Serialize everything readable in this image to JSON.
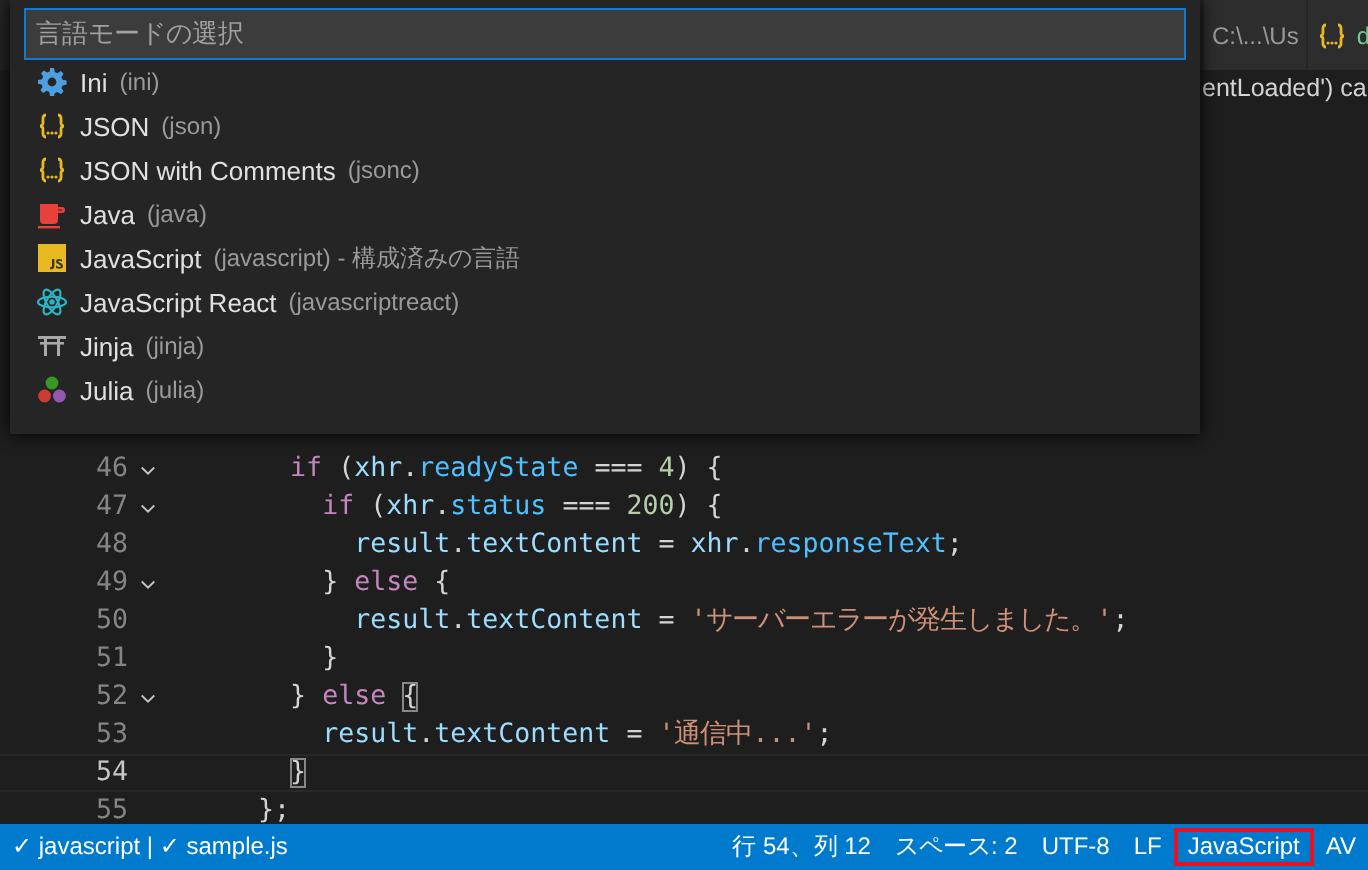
{
  "tab_bar": {
    "tabs": [
      {
        "kind": "path",
        "text": "C:\\...\\Us"
      },
      {
        "kind": "json",
        "text": "d"
      }
    ]
  },
  "editor": {
    "peek_fragment": "entLoaded') ca",
    "lines": [
      {
        "number": "46",
        "fold": true,
        "current": false,
        "tokens": [
          {
            "kind": "keyword",
            "text": "        if"
          },
          {
            "kind": "plain",
            "text": " ("
          },
          {
            "kind": "variable",
            "text": "xhr"
          },
          {
            "kind": "plain",
            "text": "."
          },
          {
            "kind": "property",
            "text": "readyState"
          },
          {
            "kind": "plain",
            "text": " === "
          },
          {
            "kind": "number",
            "text": "4"
          },
          {
            "kind": "plain",
            "text": ") {"
          }
        ]
      },
      {
        "number": "47",
        "fold": true,
        "current": false,
        "tokens": [
          {
            "kind": "keyword",
            "text": "          if"
          },
          {
            "kind": "plain",
            "text": " ("
          },
          {
            "kind": "variable",
            "text": "xhr"
          },
          {
            "kind": "plain",
            "text": "."
          },
          {
            "kind": "property",
            "text": "status"
          },
          {
            "kind": "plain",
            "text": " === "
          },
          {
            "kind": "number",
            "text": "200"
          },
          {
            "kind": "plain",
            "text": ") {"
          }
        ]
      },
      {
        "number": "48",
        "fold": false,
        "current": false,
        "tokens": [
          {
            "kind": "variable",
            "text": "            result"
          },
          {
            "kind": "plain",
            "text": "."
          },
          {
            "kind": "variable",
            "text": "textContent"
          },
          {
            "kind": "plain",
            "text": " = "
          },
          {
            "kind": "variable",
            "text": "xhr"
          },
          {
            "kind": "plain",
            "text": "."
          },
          {
            "kind": "property",
            "text": "responseText"
          },
          {
            "kind": "plain",
            "text": ";"
          }
        ]
      },
      {
        "number": "49",
        "fold": true,
        "current": false,
        "tokens": [
          {
            "kind": "plain",
            "text": "          } "
          },
          {
            "kind": "keyword",
            "text": "else"
          },
          {
            "kind": "plain",
            "text": " {"
          }
        ]
      },
      {
        "number": "50",
        "fold": false,
        "current": false,
        "tokens": [
          {
            "kind": "variable",
            "text": "            result"
          },
          {
            "kind": "plain",
            "text": "."
          },
          {
            "kind": "variable",
            "text": "textContent"
          },
          {
            "kind": "plain",
            "text": " = "
          },
          {
            "kind": "string",
            "text": "'サーバーエラーが発生しました。'"
          },
          {
            "kind": "plain",
            "text": ";"
          }
        ]
      },
      {
        "number": "51",
        "fold": false,
        "current": false,
        "tokens": [
          {
            "kind": "plain",
            "text": "          }"
          }
        ]
      },
      {
        "number": "52",
        "fold": true,
        "current": false,
        "tokens": [
          {
            "kind": "plain",
            "text": "        } "
          },
          {
            "kind": "keyword",
            "text": "else"
          },
          {
            "kind": "bracket_match",
            "text": " {"
          }
        ]
      },
      {
        "number": "53",
        "fold": false,
        "current": false,
        "tokens": [
          {
            "kind": "variable",
            "text": "          result"
          },
          {
            "kind": "plain",
            "text": "."
          },
          {
            "kind": "variable",
            "text": "textContent"
          },
          {
            "kind": "plain",
            "text": " = "
          },
          {
            "kind": "string",
            "text": "'通信中...'"
          },
          {
            "kind": "plain",
            "text": ";"
          }
        ]
      },
      {
        "number": "54",
        "fold": false,
        "current": true,
        "tokens": [
          {
            "kind": "bracket_match",
            "text": "        }"
          }
        ]
      },
      {
        "number": "55",
        "fold": false,
        "current": false,
        "tokens": [
          {
            "kind": "plain",
            "text": "      };"
          }
        ]
      }
    ]
  },
  "picker": {
    "placeholder": "言語モードの選択",
    "items": [
      {
        "kind": "gear",
        "name": "Ini",
        "id": "(ini)"
      },
      {
        "kind": "braces",
        "name": "JSON",
        "id": "(json)"
      },
      {
        "kind": "braces",
        "name": "JSON with Comments",
        "id": "(jsonc)"
      },
      {
        "kind": "cup",
        "name": "Java",
        "id": "(java)"
      },
      {
        "kind": "js",
        "name": "JavaScript",
        "id": "(javascript)",
        "description": "- 構成済みの言語"
      },
      {
        "kind": "atom",
        "name": "JavaScript React",
        "id": "(javascriptreact)"
      },
      {
        "kind": "gate",
        "name": "Jinja",
        "id": "(jinja)"
      },
      {
        "kind": "dots",
        "name": "Julia",
        "id": "(julia)"
      }
    ]
  },
  "status_bar": {
    "left": "✓ javascript | ✓ sample.js",
    "right": [
      {
        "text": "行 54、列 12",
        "highlighted": false
      },
      {
        "text": "スペース: 2",
        "highlighted": false
      },
      {
        "text": "UTF-8",
        "highlighted": false
      },
      {
        "text": "LF",
        "highlighted": false
      },
      {
        "text": "JavaScript",
        "highlighted": true
      },
      {
        "text": "AV",
        "highlighted": false
      }
    ]
  }
}
